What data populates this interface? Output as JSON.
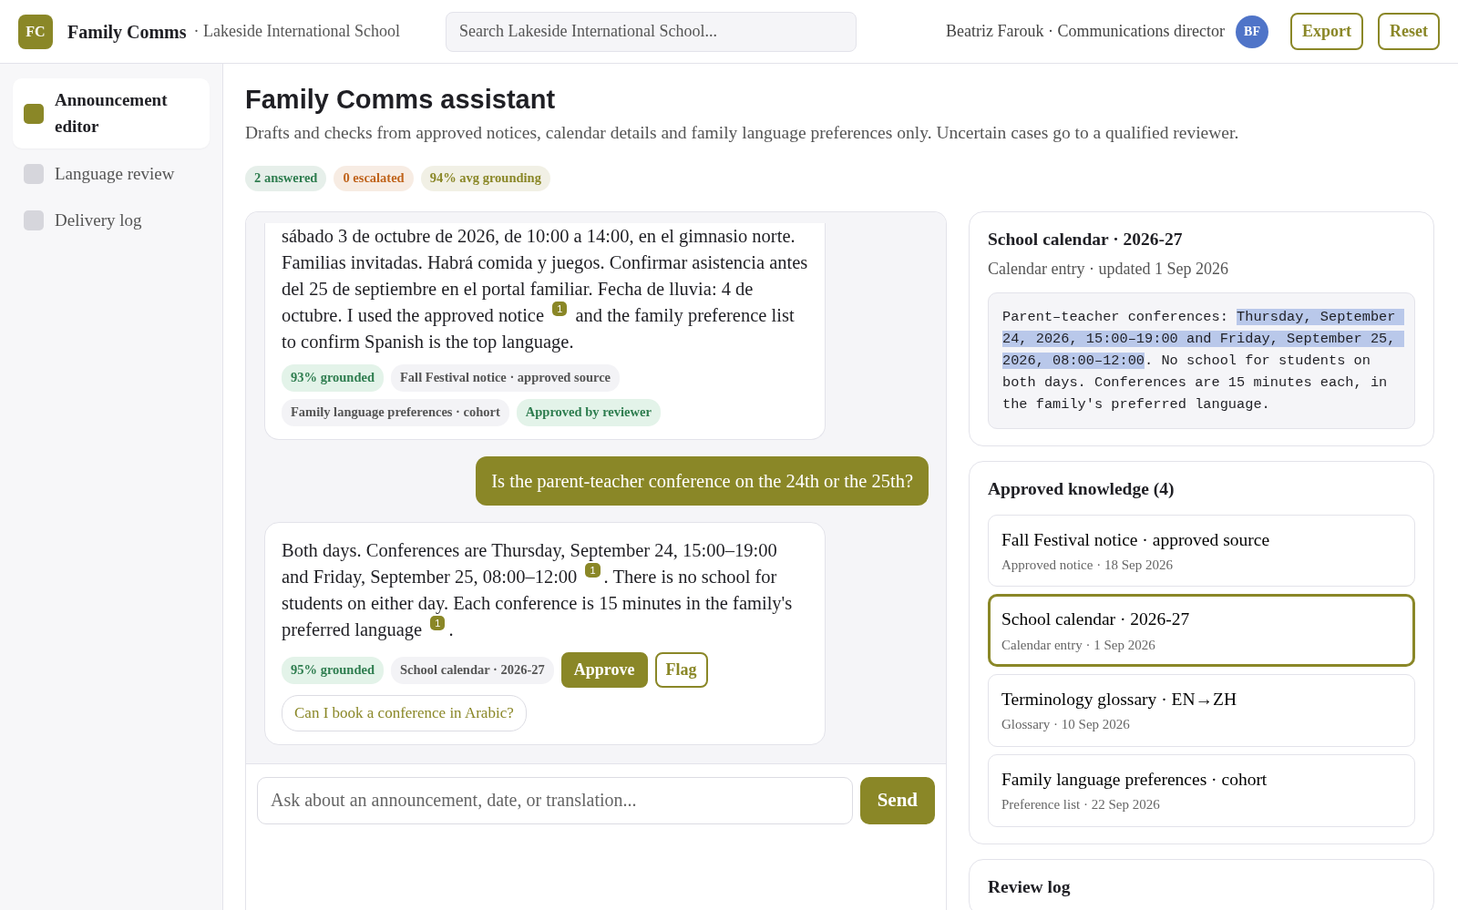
{
  "header": {
    "logo": "FC",
    "app_name": "Family Comms",
    "org": "· Lakeside International School",
    "search": {
      "placeholder": "Search Lakeside International School..."
    },
    "user": "Beatriz Farouk · Communications director",
    "avatar": "BF",
    "buttons": [
      "Export",
      "Reset"
    ]
  },
  "sidebar": {
    "items": [
      {
        "label": "Announcement editor",
        "selected": true
      },
      {
        "label": "Language review",
        "selected": false
      },
      {
        "label": "Delivery log",
        "selected": false
      }
    ]
  },
  "page": {
    "title": "Family Comms assistant",
    "subtitle": "Drafts and checks from approved notices, calendar details and family language preferences only. Uncertain cases go to a qualified reviewer.",
    "stats": [
      {
        "label": "2 answered",
        "color": "#2e7d4f"
      },
      {
        "label": "0 escalated",
        "color": "#c0641c"
      },
      {
        "label": "94% avg grounding",
        "color": "#8a8727"
      }
    ]
  },
  "chat": {
    "messages": [
      {
        "kind": "assistant",
        "text": "sábado 3 de octubre de 2026, de 10:00 a 14:00, en el gimnasio norte. Familias invitadas. Habrá comida y juegos. Confirmar asistencia antes del 25 de septiembre en el portal familiar. Fecha de lluvia: 4 de octubre. I used the approved notice $^{1}$ and the family preference list to confirm Spanish is the top language.",
        "tags": [
          {
            "kind": "grounded",
            "label": "93% grounded"
          },
          {
            "kind": "source",
            "label": "Fall Festival notice · approved source"
          },
          {
            "kind": "source",
            "label": "Family language preferences · cohort"
          },
          {
            "kind": "approved",
            "label": "Approved by reviewer"
          }
        ]
      },
      {
        "kind": "user",
        "text": "Is the parent-teacher conference on the 24th or the 25th?"
      },
      {
        "kind": "assistant",
        "text": "Both days. Conferences are Thursday, September 24, 15:00–19:00 and Friday, September 25, 08:00–12:00 $^{1}$. There is no school for students on either day. Each conference is 15 minutes in the family's preferred language $^{1}$.",
        "tags": [
          {
            "kind": "grounded",
            "label": "95% grounded"
          },
          {
            "kind": "source",
            "label": "School calendar · 2026-27"
          }
        ],
        "actions": [
          "Approve",
          "Flag"
        ],
        "suggestion": "Can I book a conference in Arabic?"
      }
    ],
    "input": {
      "placeholder": "Ask about an announcement, date, or translation..."
    },
    "send": "Send"
  },
  "source_card": {
    "title": "School calendar · 2026-27",
    "meta": "Calendar entry · updated 1 Sep 2026",
    "excerpt": [
      {
        "text": "Parent–teacher conferences: ",
        "highlighted": false
      },
      {
        "text": "Thursday, September 24, 2026, 15:00–19:00 and Friday, September 25, 2026, 08:00–12:00",
        "highlighted": true
      },
      {
        "text": ". No school for students on both days. Conferences are 15 minutes each, in the family's preferred language.",
        "highlighted": false
      }
    ]
  },
  "knowledge": {
    "title": "Approved knowledge (4)",
    "items": [
      {
        "title": "Fall Festival notice · approved source",
        "meta": "Approved notice · 18 Sep 2026",
        "selected": false
      },
      {
        "title": "School calendar · 2026-27",
        "meta": "Calendar entry · 1 Sep 2026",
        "selected": true
      },
      {
        "title": "Terminology glossary · EN→ZH",
        "meta": "Glossary · 10 Sep 2026",
        "selected": false
      },
      {
        "title": "Family language preferences · cohort",
        "meta": "Preference list · 22 Sep 2026",
        "selected": false
      }
    ]
  },
  "review_log": {
    "title": "Review log"
  }
}
